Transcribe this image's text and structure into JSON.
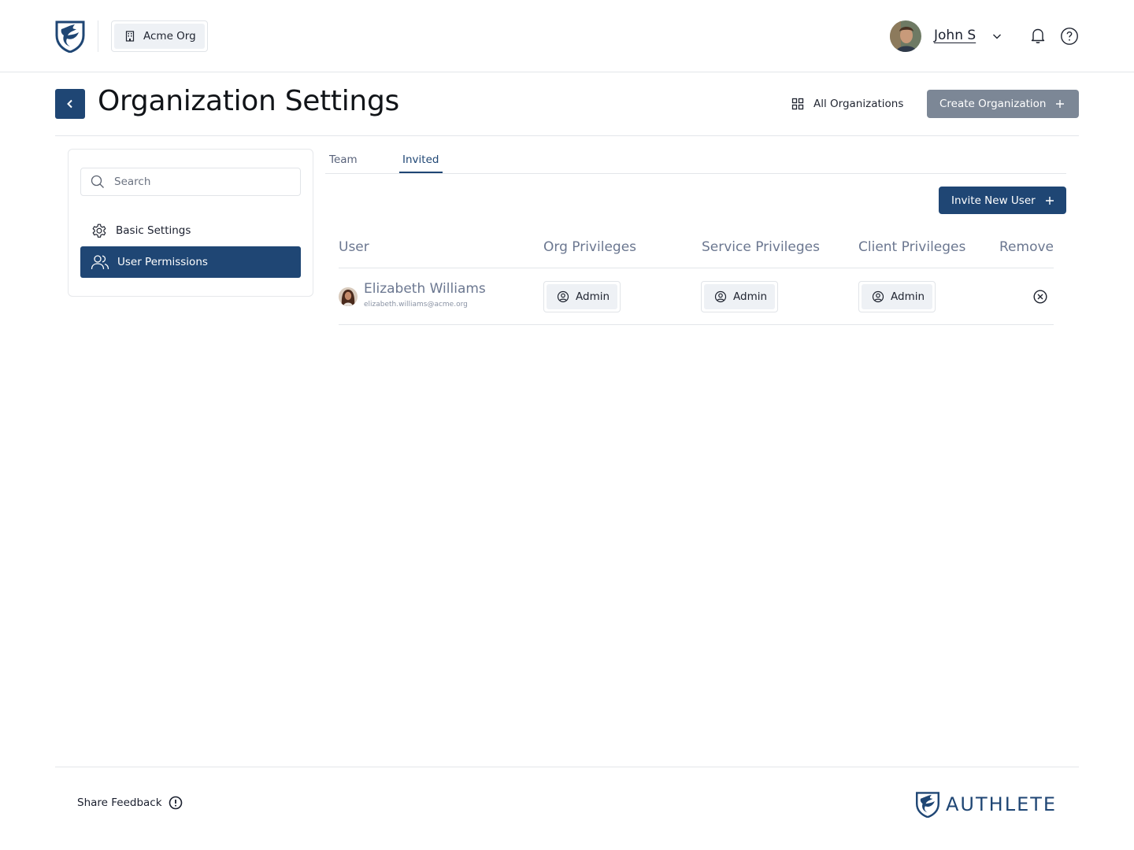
{
  "header": {
    "org_name": "Acme Org",
    "user_name": "John S"
  },
  "page": {
    "title": "Organization Settings",
    "all_orgs_label": "All Organizations",
    "create_org_label": "Create Organization"
  },
  "sidebar": {
    "search_placeholder": "Search",
    "items": [
      {
        "label": "Basic Settings",
        "icon": "gear-icon",
        "active": false
      },
      {
        "label": "User Permissions",
        "icon": "users-icon",
        "active": true
      }
    ]
  },
  "tabs": [
    {
      "label": "Team",
      "active": false
    },
    {
      "label": "Invited",
      "active": true
    }
  ],
  "invite_button_label": "Invite New User",
  "table": {
    "headers": [
      "User",
      "Org Privileges",
      "Service Privileges",
      "Client Privileges",
      "Remove"
    ],
    "rows": [
      {
        "name": "Elizabeth Williams",
        "email": "elizabeth.williams@acme.org",
        "org_privilege": "Admin",
        "service_privilege": "Admin",
        "client_privilege": "Admin"
      }
    ]
  },
  "footer": {
    "feedback_label": "Share Feedback",
    "brand": "AUTHLETE"
  },
  "colors": {
    "primary": "#1f4674",
    "disabled_button": "#7c8796",
    "muted_text": "#6b7790",
    "chip_bg": "#eef1f5"
  }
}
